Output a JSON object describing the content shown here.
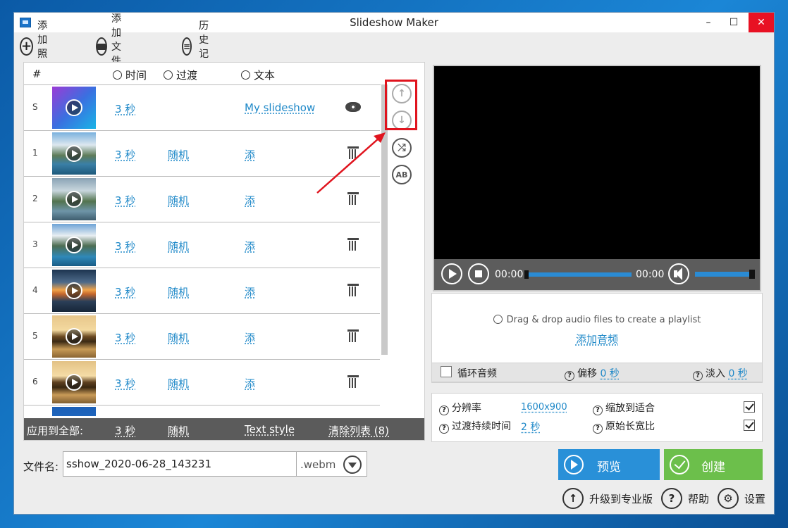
{
  "window": {
    "title": "Slideshow Maker",
    "min": "–",
    "max": "☐",
    "close": "✕"
  },
  "toolbar": {
    "add_photos": "添加照片",
    "add_folder": "添加文件夹",
    "history": "历史记录"
  },
  "list": {
    "headers": {
      "index": "#",
      "time": "时间",
      "transition": "过渡",
      "text": "文本"
    },
    "rows": [
      {
        "idx": "S",
        "time": "3 秒",
        "transition": "",
        "text": "My slideshow",
        "action": "eye-icon",
        "thumb": "gradient-blue-purple"
      },
      {
        "idx": "1",
        "time": "3 秒",
        "transition": "随机",
        "text": "添",
        "action": "trash-icon",
        "thumb": "mountain-lake"
      },
      {
        "idx": "2",
        "time": "3 秒",
        "transition": "随机",
        "text": "添",
        "action": "trash-icon",
        "thumb": "mountain-lake"
      },
      {
        "idx": "3",
        "time": "3 秒",
        "transition": "随机",
        "text": "添",
        "action": "trash-icon",
        "thumb": "mountain-lake"
      },
      {
        "idx": "4",
        "time": "3 秒",
        "transition": "随机",
        "text": "添",
        "action": "trash-icon",
        "thumb": "sunset-water"
      },
      {
        "idx": "5",
        "time": "3 秒",
        "transition": "随机",
        "text": "添",
        "action": "trash-icon",
        "thumb": "desert-tree"
      },
      {
        "idx": "6",
        "time": "3 秒",
        "transition": "随机",
        "text": "添",
        "action": "trash-icon",
        "thumb": "desert-tree"
      }
    ],
    "apply_all": {
      "label": "应用到全部:",
      "time": "3 秒",
      "transition": "随机",
      "text_style": "Text style",
      "clear": "清除列表 (8)"
    }
  },
  "player": {
    "time_current": "00:00",
    "time_total": "00:00",
    "volume": 0.9
  },
  "audio": {
    "hint": "Drag & drop audio files to create a playlist",
    "add": "添加音频",
    "loop": "循环音频",
    "offset_label": "偏移",
    "offset_value": "0 秒",
    "fadein_label": "淡入",
    "fadein_value": "0 秒"
  },
  "settings": {
    "resolution_label": "分辨率",
    "resolution_value": "1600x900",
    "scale_label": "缩放到适合",
    "transition_duration_label": "过渡持续时间",
    "transition_duration_value": "2 秒",
    "aspect_label": "原始长宽比"
  },
  "file": {
    "label": "文件名:",
    "value": "sshow_2020-06-28_143231",
    "ext": ".webm"
  },
  "actions": {
    "preview": "预览",
    "create": "创建"
  },
  "footer": {
    "upgrade": "升级到专业版",
    "help": "帮助",
    "settings": "设置"
  },
  "colors": {
    "accent": "#1e88c8",
    "preview_btn": "#2990d8",
    "create_btn": "#6cbf4b",
    "highlight": "#e0141e"
  }
}
